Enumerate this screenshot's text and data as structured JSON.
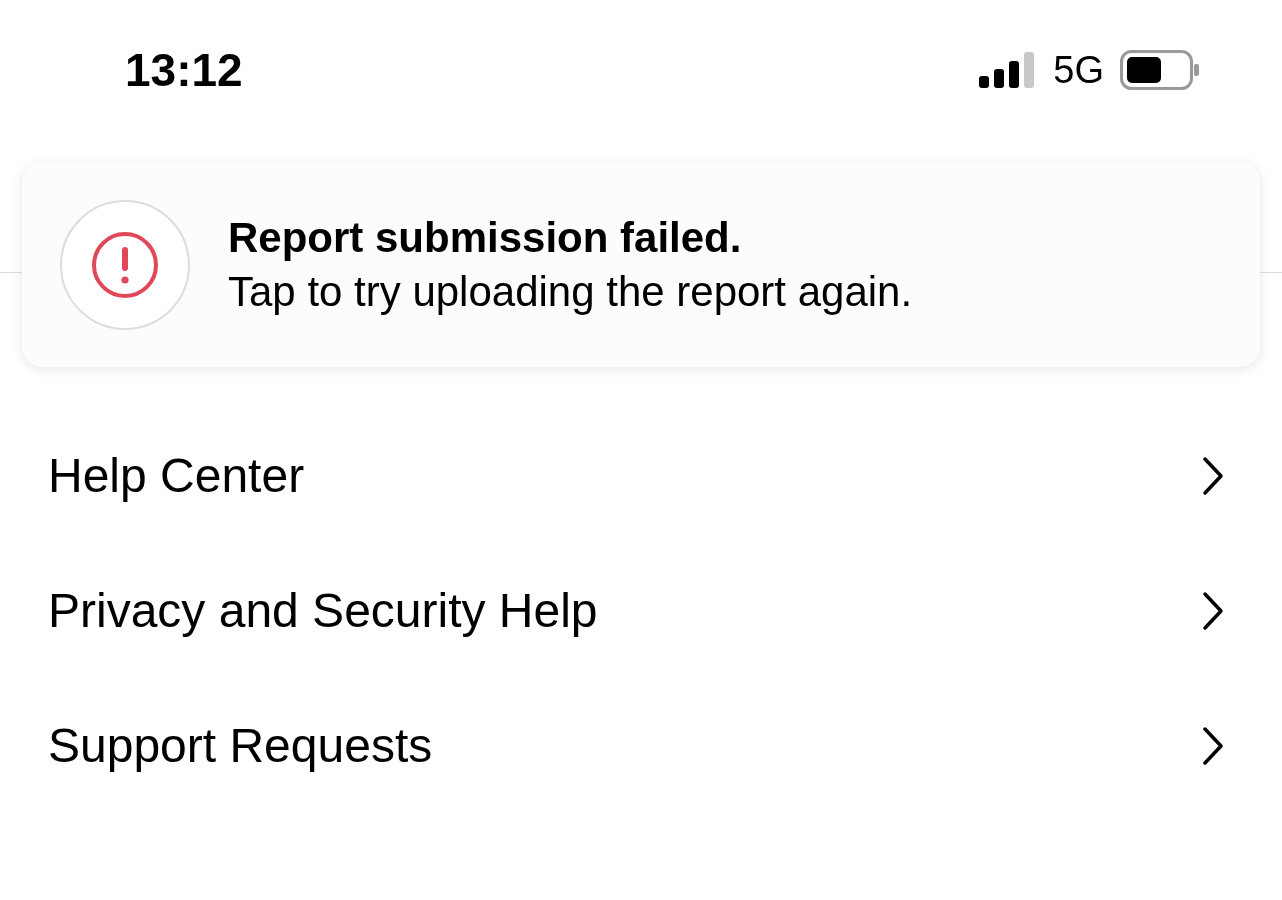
{
  "status_bar": {
    "time": "13:12",
    "network": "5G"
  },
  "menu_items": [
    {
      "label": "Help Center"
    },
    {
      "label": "Privacy and Security Help"
    },
    {
      "label": "Support Requests"
    }
  ],
  "toast": {
    "title": "Report submission failed.",
    "message": "Tap to try uploading the report again."
  }
}
